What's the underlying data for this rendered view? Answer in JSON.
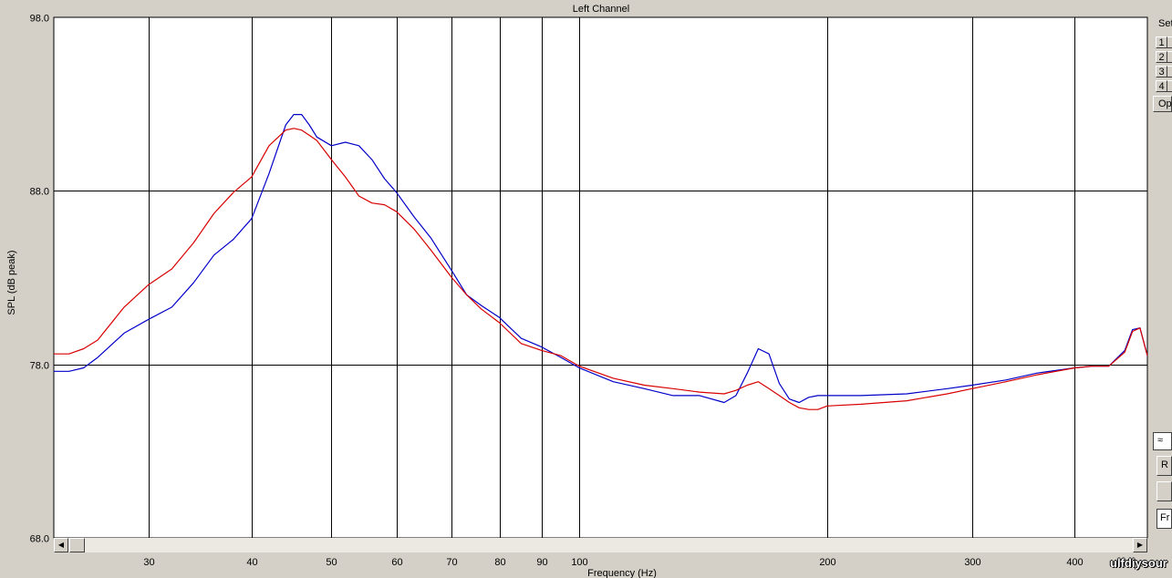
{
  "chart_data": {
    "type": "line",
    "title": "Left Channel",
    "xlabel": "Frequency (Hz)",
    "ylabel": "SPL (dB peak)",
    "x_scale": "log",
    "xlim": [
      23,
      490
    ],
    "ylim": [
      68,
      98
    ],
    "x_ticks": [
      30,
      40,
      50,
      60,
      70,
      80,
      90,
      100,
      200,
      300,
      400
    ],
    "y_ticks": [
      68.0,
      78.0,
      88.0,
      98.0
    ],
    "y_tick_labels": [
      "68.0",
      "78.0",
      "88.0",
      "98.0"
    ],
    "grid": true,
    "series": [
      {
        "color": "#0000c8",
        "x": [
          23,
          24,
          25,
          26,
          28,
          30,
          32,
          34,
          36,
          38,
          40,
          42,
          44,
          45,
          46,
          47,
          48,
          50,
          52,
          54,
          56,
          58,
          60,
          63,
          66,
          70,
          73,
          76,
          80,
          85,
          90,
          95,
          100,
          110,
          120,
          130,
          140,
          150,
          155,
          160,
          165,
          170,
          175,
          180,
          185,
          190,
          195,
          200,
          220,
          250,
          280,
          300,
          330,
          360,
          400,
          420,
          440,
          460,
          470,
          480,
          490
        ],
        "y": [
          77.6,
          77.6,
          77.8,
          78.4,
          79.8,
          80.6,
          81.3,
          82.7,
          84.3,
          85.2,
          86.4,
          89.0,
          91.8,
          92.4,
          92.4,
          91.8,
          91.1,
          90.6,
          90.8,
          90.6,
          89.8,
          88.7,
          87.9,
          86.5,
          85.3,
          83.4,
          82.0,
          81.4,
          80.7,
          79.5,
          79.0,
          78.4,
          77.8,
          77.0,
          76.6,
          76.2,
          76.2,
          75.8,
          76.2,
          77.5,
          78.9,
          78.6,
          76.9,
          76.0,
          75.8,
          76.1,
          76.2,
          76.2,
          76.2,
          76.3,
          76.6,
          76.8,
          77.1,
          77.5,
          77.8,
          77.9,
          77.9,
          78.8,
          80.0,
          80.1,
          78.5
        ]
      },
      {
        "color": "#d80000",
        "x": [
          23,
          24,
          25,
          26,
          28,
          30,
          32,
          34,
          36,
          38,
          40,
          42,
          44,
          45,
          46,
          47,
          48,
          50,
          52,
          54,
          56,
          58,
          60,
          63,
          66,
          70,
          73,
          76,
          80,
          85,
          90,
          95,
          100,
          110,
          120,
          130,
          140,
          150,
          155,
          160,
          165,
          170,
          175,
          180,
          185,
          190,
          195,
          200,
          220,
          250,
          280,
          300,
          330,
          360,
          400,
          420,
          440,
          460,
          470,
          480,
          490
        ],
        "y": [
          78.6,
          78.6,
          78.9,
          79.4,
          81.3,
          82.6,
          83.5,
          85.0,
          86.7,
          87.9,
          88.8,
          90.6,
          91.5,
          91.6,
          91.5,
          91.2,
          90.9,
          89.8,
          88.8,
          87.7,
          87.3,
          87.2,
          86.8,
          85.8,
          84.6,
          83.0,
          82.0,
          81.2,
          80.4,
          79.2,
          78.8,
          78.5,
          77.9,
          77.2,
          76.8,
          76.6,
          76.4,
          76.3,
          76.5,
          76.8,
          77.0,
          76.6,
          76.2,
          75.8,
          75.5,
          75.4,
          75.4,
          75.6,
          75.7,
          75.9,
          76.3,
          76.6,
          77.0,
          77.4,
          77.8,
          77.9,
          77.9,
          78.7,
          79.9,
          80.1,
          78.5
        ]
      }
    ]
  },
  "side_panel": {
    "label_set": "Set",
    "buttons": [
      "1",
      "2",
      "3",
      "4"
    ],
    "op_label": "Op",
    "icon_name": "waveform-icon",
    "r_label": "R",
    "fr_label": "Fr"
  },
  "scrollbar": {
    "left_icon": "arrow-left-icon",
    "right_icon": "arrow-right-icon"
  },
  "watermark": "ulfdiysour"
}
